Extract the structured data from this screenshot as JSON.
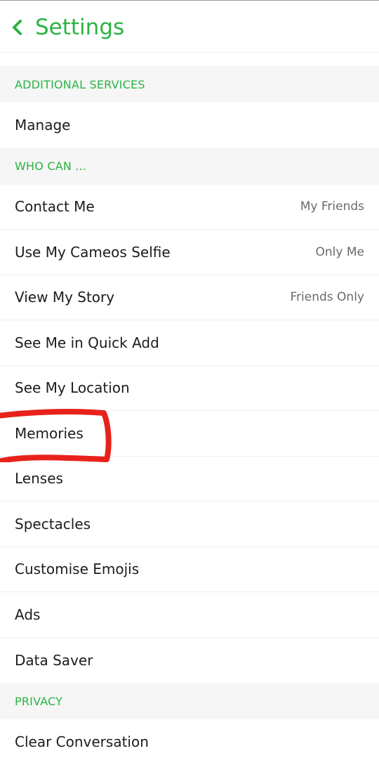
{
  "header": {
    "title": "Settings",
    "back_icon": "chevron-left-icon",
    "accent": "#2bb342"
  },
  "sections": {
    "additional_services": "ADDITIONAL SERVICES",
    "who_can": "WHO CAN ...",
    "privacy": "PRIVACY"
  },
  "rows": {
    "manage": {
      "label": "Manage"
    },
    "contact_me": {
      "label": "Contact Me",
      "value": "My Friends"
    },
    "cameos_selfie": {
      "label": "Use My Cameos Selfie",
      "value": "Only Me"
    },
    "view_story": {
      "label": "View My Story",
      "value": "Friends Only"
    },
    "quick_add": {
      "label": "See Me in Quick Add"
    },
    "location": {
      "label": "See My Location"
    },
    "memories": {
      "label": "Memories"
    },
    "lenses": {
      "label": "Lenses"
    },
    "spectacles": {
      "label": "Spectacles"
    },
    "emojis": {
      "label": "Customise Emojis"
    },
    "ads": {
      "label": "Ads"
    },
    "data_saver": {
      "label": "Data Saver"
    },
    "clear_conversation": {
      "label": "Clear Conversation"
    }
  },
  "annotation_color": "#e8221b"
}
